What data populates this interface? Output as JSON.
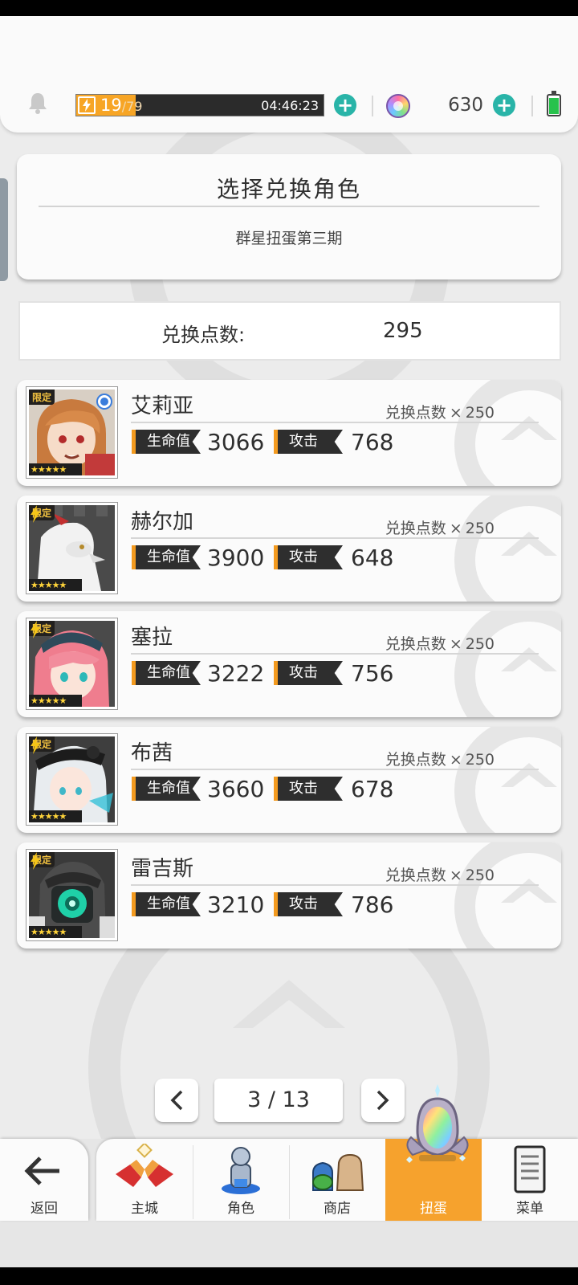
{
  "status_bar": {
    "stamina_current": "19",
    "stamina_max": "/79",
    "stamina_fraction": 0.24,
    "timer": "04:46:23",
    "gems": "630",
    "icons": [
      "bell-icon",
      "lightning-icon",
      "plus-icon",
      "rainbow-gem-icon",
      "battery-icon"
    ]
  },
  "panel": {
    "title": "选择兑换角色",
    "subtitle": "群星扭蛋第三期"
  },
  "points": {
    "label": "兑换点数:",
    "value": "295"
  },
  "labels": {
    "limited": "限定",
    "stars": "★★★★★",
    "hp": "生命值",
    "atk": "攻击",
    "cost_label": "兑换点数",
    "cost_x": "×"
  },
  "characters": [
    {
      "name": "艾莉亚",
      "cost": "250",
      "hp": "3066",
      "atk": "768",
      "selected": true
    },
    {
      "name": "赫尔加",
      "cost": "250",
      "hp": "3900",
      "atk": "648",
      "selected": false
    },
    {
      "name": "塞拉",
      "cost": "250",
      "hp": "3222",
      "atk": "756",
      "selected": false
    },
    {
      "name": "布茜",
      "cost": "250",
      "hp": "3660",
      "atk": "678",
      "selected": false
    },
    {
      "name": "雷吉斯",
      "cost": "250",
      "hp": "3210",
      "atk": "786",
      "selected": false
    }
  ],
  "pagination": {
    "label": "3 / 13"
  },
  "nav": {
    "back": "返回",
    "items": [
      {
        "label": "主城",
        "icon": "castle-icon"
      },
      {
        "label": "角色",
        "icon": "character-icon"
      },
      {
        "label": "商店",
        "icon": "shop-bag-icon"
      },
      {
        "label": "扭蛋",
        "icon": "gacha-mirror-icon"
      },
      {
        "label": "菜单",
        "icon": "menu-list-icon"
      }
    ],
    "active": "扭蛋"
  },
  "colors": {
    "accent_orange": "#f6a22d",
    "teal_plus": "#29b4a8",
    "stat_tag_dark": "#2e2e2e",
    "selected_blue": "#3b7ddb"
  }
}
